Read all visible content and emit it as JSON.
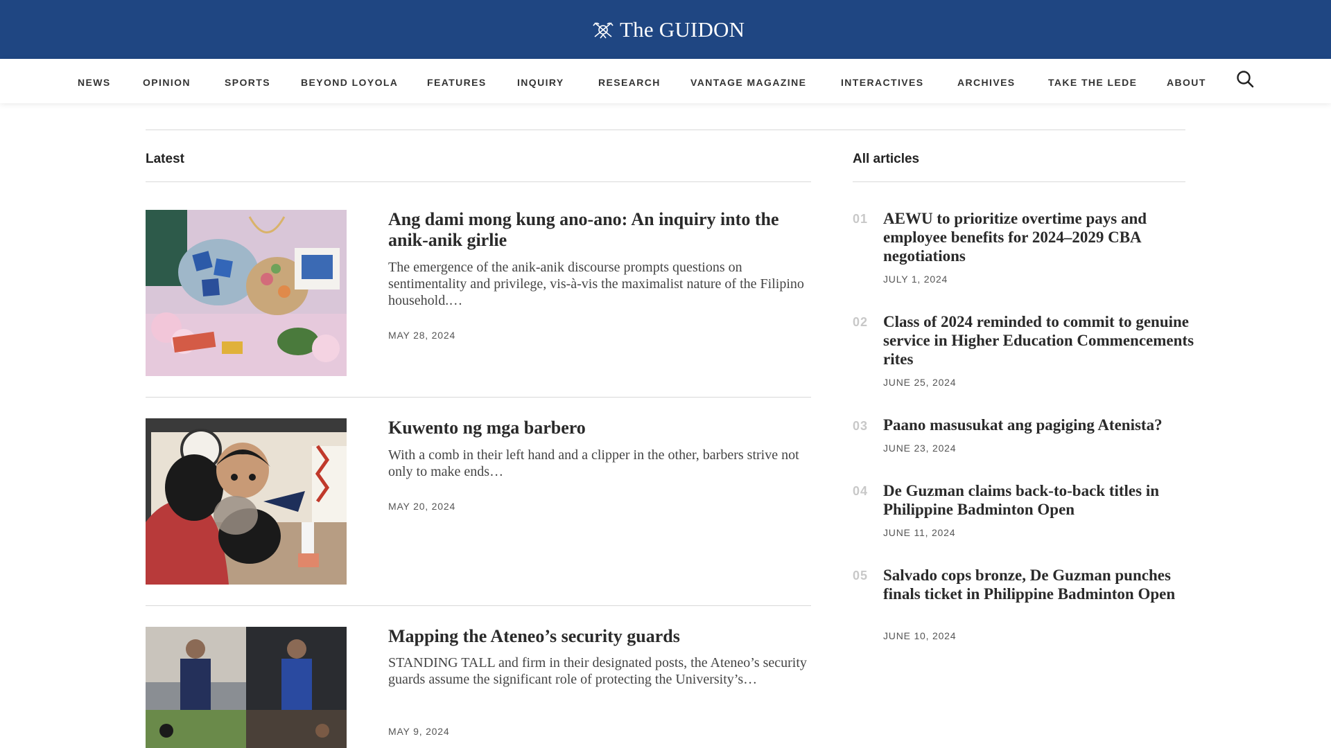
{
  "header": {
    "site_name": "The GUIDON",
    "logo_icon": "crest-icon",
    "brand_color": "#1f4682"
  },
  "nav": {
    "items": [
      {
        "label": "NEWS"
      },
      {
        "label": "OPINION"
      },
      {
        "label": "SPORTS"
      },
      {
        "label": "BEYOND LOYOLA"
      },
      {
        "label": "FEATURES"
      },
      {
        "label": "INQUIRY"
      },
      {
        "label": "RESEARCH"
      },
      {
        "label": "VANTAGE MAGAZINE"
      },
      {
        "label": "INTERACTIVES"
      },
      {
        "label": "ARCHIVES"
      },
      {
        "label": "TAKE THE LEDE"
      },
      {
        "label": "ABOUT"
      }
    ],
    "search_icon": "search-icon"
  },
  "latest": {
    "heading": "Latest",
    "articles": [
      {
        "title": "Ang dami mong kung ano-ano: An inquiry into the anik-anik girlie",
        "excerpt": " The emergence of the anik-anik discourse prompts questions on sentimentality and privilege, vis-à-vis the maximalist nature of the Filipino household.…",
        "date": "MAY 28, 2024"
      },
      {
        "title": "Kuwento ng mga barbero",
        "excerpt": "With a comb in their left hand and a clipper in the other, barbers strive not only to make ends…",
        "date": "MAY 20, 2024"
      },
      {
        "title": "Mapping the Ateneo’s security guards",
        "excerpt": "STANDING TALL and firm in their designated posts, the Ateneo’s security guards assume the significant role of protecting the University’s…",
        "date": "MAY 9, 2024"
      }
    ]
  },
  "all_articles": {
    "heading": "All articles",
    "items": [
      {
        "num": "01",
        "title": "AEWU to prioritize overtime pays and employee benefits for 2024–2029 CBA negotiations",
        "date": "JULY 1, 2024"
      },
      {
        "num": "02",
        "title": "Class of 2024 reminded to commit to genuine service in Higher Education Commencements rites",
        "date": "JUNE 25, 2024"
      },
      {
        "num": "03",
        "title": "Paano masusukat ang pagiging Atenista?",
        "date": "JUNE 23, 2024"
      },
      {
        "num": "04",
        "title": "De Guzman claims back-to-back titles in Philippine Badminton Open",
        "date": "JUNE 11, 2024"
      },
      {
        "num": "05",
        "title": "Salvado cops bronze, De Guzman punches finals ticket in Philippine Badminton Open",
        "date": "JUNE 10, 2024"
      }
    ]
  }
}
